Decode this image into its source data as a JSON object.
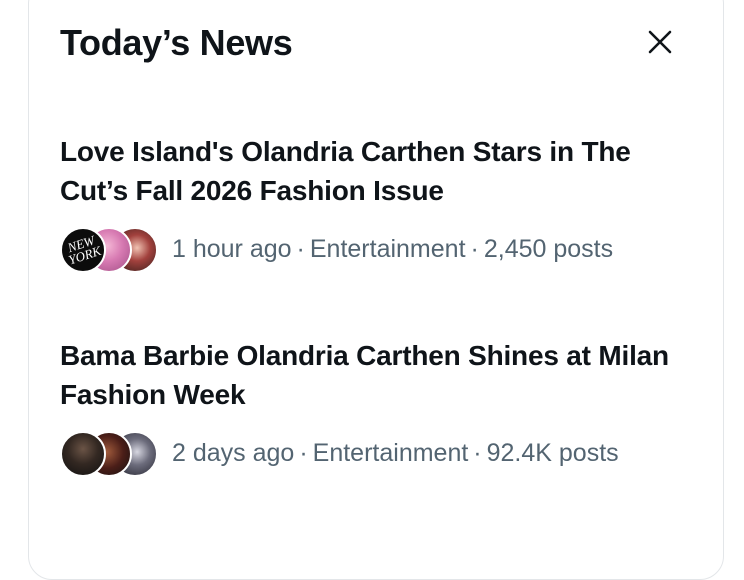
{
  "panel": {
    "title": "Today’s News",
    "close_icon": "close-icon"
  },
  "stories": [
    {
      "headline": "Love Island's Olandria Carthen Stars in The Cut’s Fall 2026 Fashion Issue",
      "time": "1 hour ago",
      "category": "Entertainment",
      "posts": "2,450 posts",
      "avatar_text": [
        "NEW",
        "YORK"
      ]
    },
    {
      "headline": "Bama Barbie Olandria Carthen Shines at Milan Fashion Week",
      "time": "2 days ago",
      "category": "Entertainment",
      "posts": "92.4K posts"
    }
  ],
  "separator": "·",
  "colors": {
    "text_primary": "#0f1419",
    "text_secondary": "#536471",
    "border": "#e3e6e9",
    "background": "#ffffff"
  }
}
